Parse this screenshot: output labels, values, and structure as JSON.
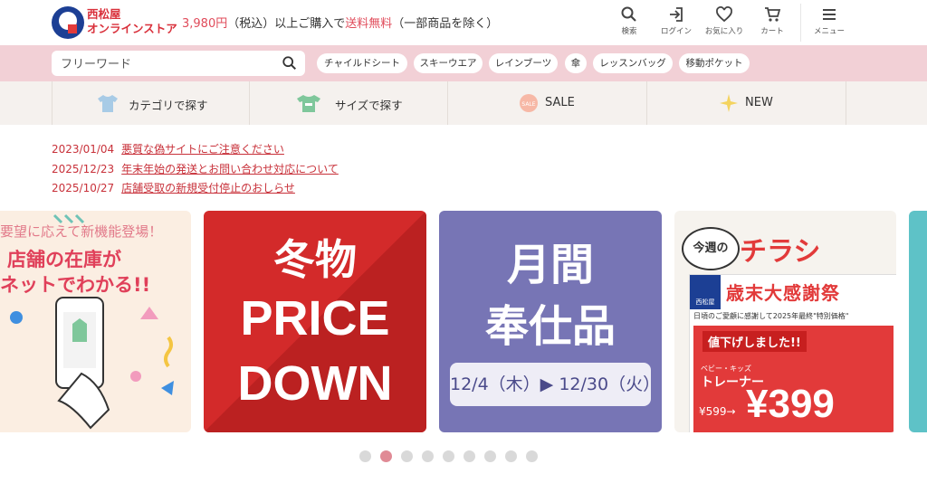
{
  "header": {
    "brand_line1": "西松屋",
    "brand_line2": "オンラインストア",
    "promo_price": "3,980円",
    "promo_mid": "（税込）以上ご購入で",
    "promo_free": "送料無料",
    "promo_tail": "（一部商品を除く）",
    "icons": [
      {
        "label": "検索",
        "icon": "search-icon"
      },
      {
        "label": "ログイン",
        "icon": "login-icon"
      },
      {
        "label": "お気に入り",
        "icon": "heart-icon"
      },
      {
        "label": "カート",
        "icon": "cart-icon"
      },
      {
        "label": "メニュー",
        "icon": "menu-icon"
      }
    ]
  },
  "search": {
    "placeholder": "フリーワード",
    "tags": [
      "チャイルドシート",
      "スキーウエア",
      "レインブーツ",
      "傘",
      "レッスンバッグ",
      "移動ポケット"
    ]
  },
  "categories": [
    {
      "label": "カテゴリで探す",
      "icon": "tshirt-icon"
    },
    {
      "label": "サイズで探す",
      "icon": "shirt-size-icon"
    },
    {
      "label": "SALE",
      "icon": "sale-icon"
    },
    {
      "label": "NEW",
      "icon": "sparkle-icon"
    }
  ],
  "news": [
    {
      "date": "2023/01/04",
      "title": "悪質な偽サイトにご注意ください"
    },
    {
      "date": "2025/12/23",
      "title": "年末年始の発送とお問い合わせ対応について"
    },
    {
      "date": "2025/10/27",
      "title": "店舗受取の新規受付停止のおしらせ"
    }
  ],
  "banners": {
    "b1": {
      "line0": "要望に応えて新機能登場！",
      "line1": "店舗の在庫が",
      "line2": "ネットでわかる!!"
    },
    "b2": {
      "line1": "冬物",
      "line2": "PRICE",
      "line3": "DOWN"
    },
    "b3": {
      "line1": "月間",
      "line2": "奉仕品",
      "period": "12/4（木）▶ 12/30（火）"
    },
    "b4": {
      "weekly": "今週の",
      "flyer": "チラシ",
      "sale_title": "歳末大感謝祭",
      "sub": "日頃のご愛顧に感謝して2025年最終\"特別価格\"",
      "price_down": "値下げしました!!",
      "item": "トレーナー",
      "item_cat": "ベビー・キッズ",
      "old_price": "¥599→",
      "new_price": "¥399",
      "logo": "西松屋"
    }
  },
  "carousel": {
    "count": 9,
    "active_index": 1
  },
  "colors": {
    "brand_red": "#d9303b",
    "brand_navy": "#1c3f94",
    "pink_bar": "#f2d0d6",
    "news_red": "#c8313a"
  }
}
